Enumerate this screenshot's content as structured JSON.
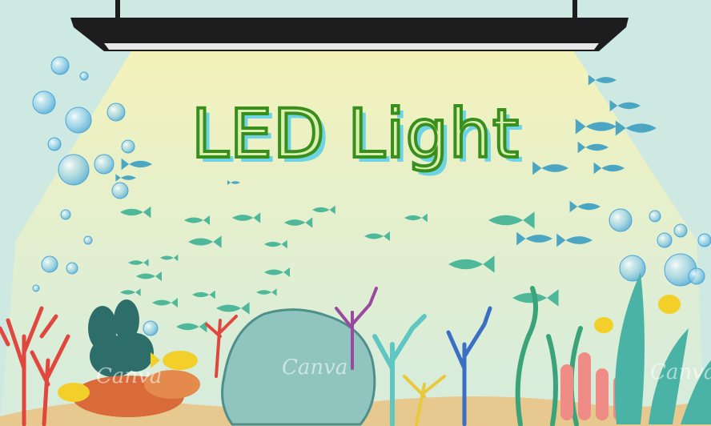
{
  "title": "LED Light",
  "watermark": "Canva",
  "colors": {
    "water": "#cde9e1",
    "light_cone": "#f3f5c8",
    "lamp_body": "#1d1d1d",
    "title_stroke": "#3a8f1c",
    "title_shadow": "#6fd3e6",
    "fish_blue": "#4aa6c3",
    "fish_green": "#4fb89a"
  },
  "icons": [
    "led-lamp-icon",
    "fish-icon",
    "bubble-icon",
    "coral-icon",
    "rock-icon",
    "seaweed-icon"
  ]
}
